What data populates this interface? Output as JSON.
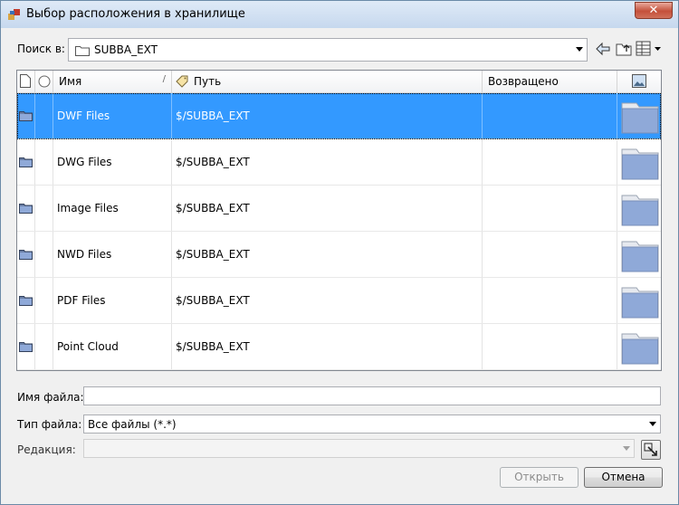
{
  "window": {
    "title": "Выбор расположения в хранилище",
    "close_label": "✕"
  },
  "lookin": {
    "label": "Поиск в:",
    "value": "SUBBA_EXT"
  },
  "columns": {
    "name": "Имя",
    "path": "Путь",
    "returned": "Возвращено",
    "sort_indicator": "/"
  },
  "rows": [
    {
      "name": "DWF Files",
      "path": "$/SUBBA_EXT",
      "returned": "",
      "selected": true
    },
    {
      "name": "DWG Files",
      "path": "$/SUBBA_EXT",
      "returned": ""
    },
    {
      "name": "Image Files",
      "path": "$/SUBBA_EXT",
      "returned": ""
    },
    {
      "name": "NWD Files",
      "path": "$/SUBBA_EXT",
      "returned": ""
    },
    {
      "name": "PDF Files",
      "path": "$/SUBBA_EXT",
      "returned": ""
    },
    {
      "name": "Point Cloud",
      "path": "$/SUBBA_EXT",
      "returned": ""
    }
  ],
  "form": {
    "filename_label": "Имя файла:",
    "filename_value": "",
    "filetype_label": "Тип файла:",
    "filetype_value": "Все файлы (*.*)",
    "revision_label": "Редакция:",
    "revision_value": ""
  },
  "buttons": {
    "open": "Открыть",
    "cancel": "Отмена"
  },
  "colors": {
    "selection": "#3399ff",
    "folder": "#8fa9d8"
  }
}
